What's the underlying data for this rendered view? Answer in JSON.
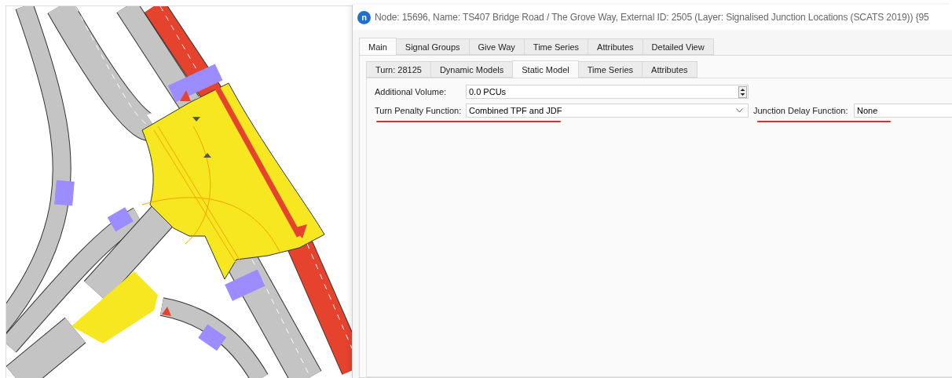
{
  "window": {
    "app_icon": "n",
    "title": "Node: 15696, Name: TS407 Bridge Road / The Grove Way, External ID: 2505 (Layer: Signalised Junction Locations (SCATS 2019)) {95"
  },
  "tabs": [
    {
      "label": "Main",
      "selected": true
    },
    {
      "label": "Signal Groups",
      "selected": false
    },
    {
      "label": "Give Way",
      "selected": false
    },
    {
      "label": "Time Series",
      "selected": false
    },
    {
      "label": "Attributes",
      "selected": false
    },
    {
      "label": "Detailed View",
      "selected": false
    }
  ],
  "subtabs": [
    {
      "label": "Turn: 28125",
      "selected": false
    },
    {
      "label": "Dynamic Models",
      "selected": false
    },
    {
      "label": "Static Model",
      "selected": true
    },
    {
      "label": "Time Series",
      "selected": false
    },
    {
      "label": "Attributes",
      "selected": false
    }
  ],
  "form": {
    "additional_volume": {
      "label": "Additional Volume:",
      "value": "0.0 PCUs"
    },
    "turn_penalty_function": {
      "label": "Turn Penalty Function:",
      "value": "Combined TPF and JDF",
      "underlined": true
    },
    "junction_delay_function": {
      "label": "Junction Delay Function:",
      "value": "None",
      "underlined": true
    }
  }
}
